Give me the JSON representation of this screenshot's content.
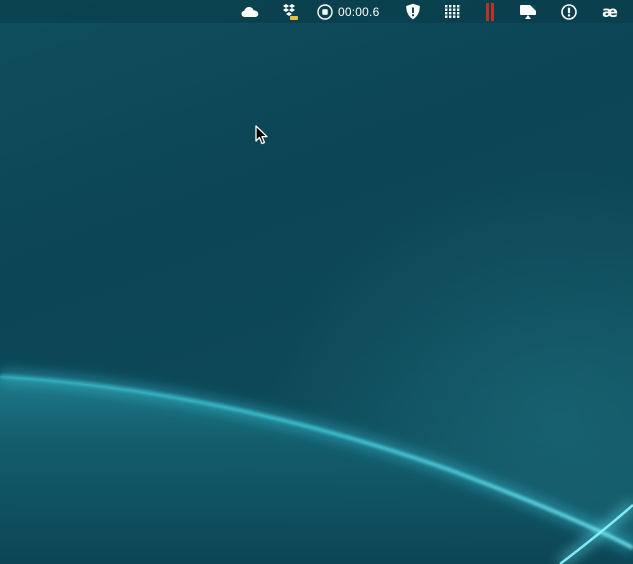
{
  "desktop": {
    "wallpaper_color": "#0d4858",
    "accent_glow": "#40e0f0"
  },
  "menubar": {
    "items": [
      {
        "icon": "cloud-icon"
      },
      {
        "icon": "dropbox-icon"
      },
      {
        "icon": "stop-recording-icon",
        "timer": "00:00.6"
      },
      {
        "icon": "shield-icon"
      },
      {
        "icon": "grid-icon"
      },
      {
        "icon": "pause-icon",
        "color": "#c0392b"
      },
      {
        "icon": "display-icon"
      },
      {
        "icon": "info-icon"
      },
      {
        "icon": "ae-icon",
        "text": "æ"
      }
    ]
  },
  "cursor": {
    "icon": "arrow-cursor-icon"
  }
}
